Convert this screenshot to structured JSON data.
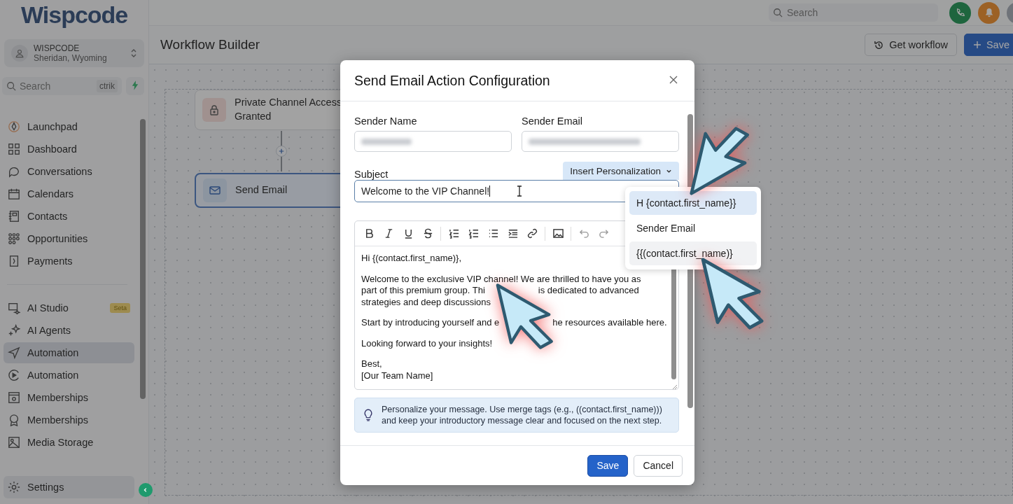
{
  "logo": "Wispcode",
  "account": {
    "name": "WISPCODE",
    "location": "Sheridan, Wyoming"
  },
  "sidebar_search": {
    "placeholder": "Search",
    "shortcut": "ctrik"
  },
  "nav_groups": [
    {
      "items": [
        {
          "label": "Launchpad",
          "selected": false
        },
        {
          "label": "Dashboard",
          "selected": false
        },
        {
          "label": "Conversations",
          "selected": false
        },
        {
          "label": "Calendars",
          "selected": false
        },
        {
          "label": "Contacts",
          "selected": false
        },
        {
          "label": "Opportunities",
          "selected": false
        },
        {
          "label": "Payments",
          "selected": false
        }
      ]
    },
    {
      "items": [
        {
          "label": "AI Studio",
          "selected": false,
          "badge": "Seta"
        },
        {
          "label": "AI Agents",
          "selected": false
        },
        {
          "label": "Automation",
          "selected": true
        },
        {
          "label": "Automation",
          "selected": false
        },
        {
          "label": "Memberships",
          "selected": false
        },
        {
          "label": "Memberships",
          "selected": false
        },
        {
          "label": "Media Storage",
          "selected": false
        }
      ]
    }
  ],
  "settings": {
    "label": "Settings"
  },
  "top_search": {
    "placeholder": "Search"
  },
  "page_title": "Workflow Builder",
  "header_buttons": [
    {
      "kind": "secondary",
      "label": "Get workflow"
    },
    {
      "kind": "primary",
      "label": "Save"
    }
  ],
  "nodes": [
    {
      "label": "Private Channel Access Granted",
      "selected": false
    },
    {
      "label": "Send Email",
      "selected": true
    }
  ],
  "modal": {
    "title": "Send Email Action Configuration",
    "sender_name": {
      "label": "Sender Name"
    },
    "sender_email": {
      "label": "Sender Email"
    },
    "subject": {
      "label": "Subject",
      "value": "Welcome to the VIP Channel!"
    },
    "personalize_button": "Insert Personalization",
    "menu": [
      {
        "label": "H {contact.first_name}}",
        "selected": true,
        "hovered": false
      },
      {
        "label": "Sender Email",
        "selected": false,
        "hovered": false
      },
      {
        "label": "{{(contact.first_name)}",
        "selected": false,
        "hovered": true
      }
    ],
    "body": [
      [
        [
          "Hi {(contact.first_name)},"
        ]
      ],
      [
        [
          "Welcome to the exclusive VIP channel! We are thrilled to have you as"
        ],
        [
          "part of this premium group. Thi",
          "is dedicated to advanced"
        ],
        [
          "strategies and deep discussions"
        ]
      ],
      [
        [
          "Start by introducing yourself and e",
          "he resources available here."
        ]
      ],
      [
        [
          "Looking forward to your insights!"
        ]
      ],
      [
        [
          "Best,"
        ],
        [
          "[Our Team Name]"
        ]
      ]
    ],
    "tip": "Personalize your message. Use merge tags (e.g., ((contact.first_name))) and keep your introductory message clear and focused on the next step.",
    "buttons": [
      {
        "kind": "primary",
        "label": "Save"
      },
      {
        "kind": "secondary",
        "label": "Cancel"
      }
    ]
  }
}
